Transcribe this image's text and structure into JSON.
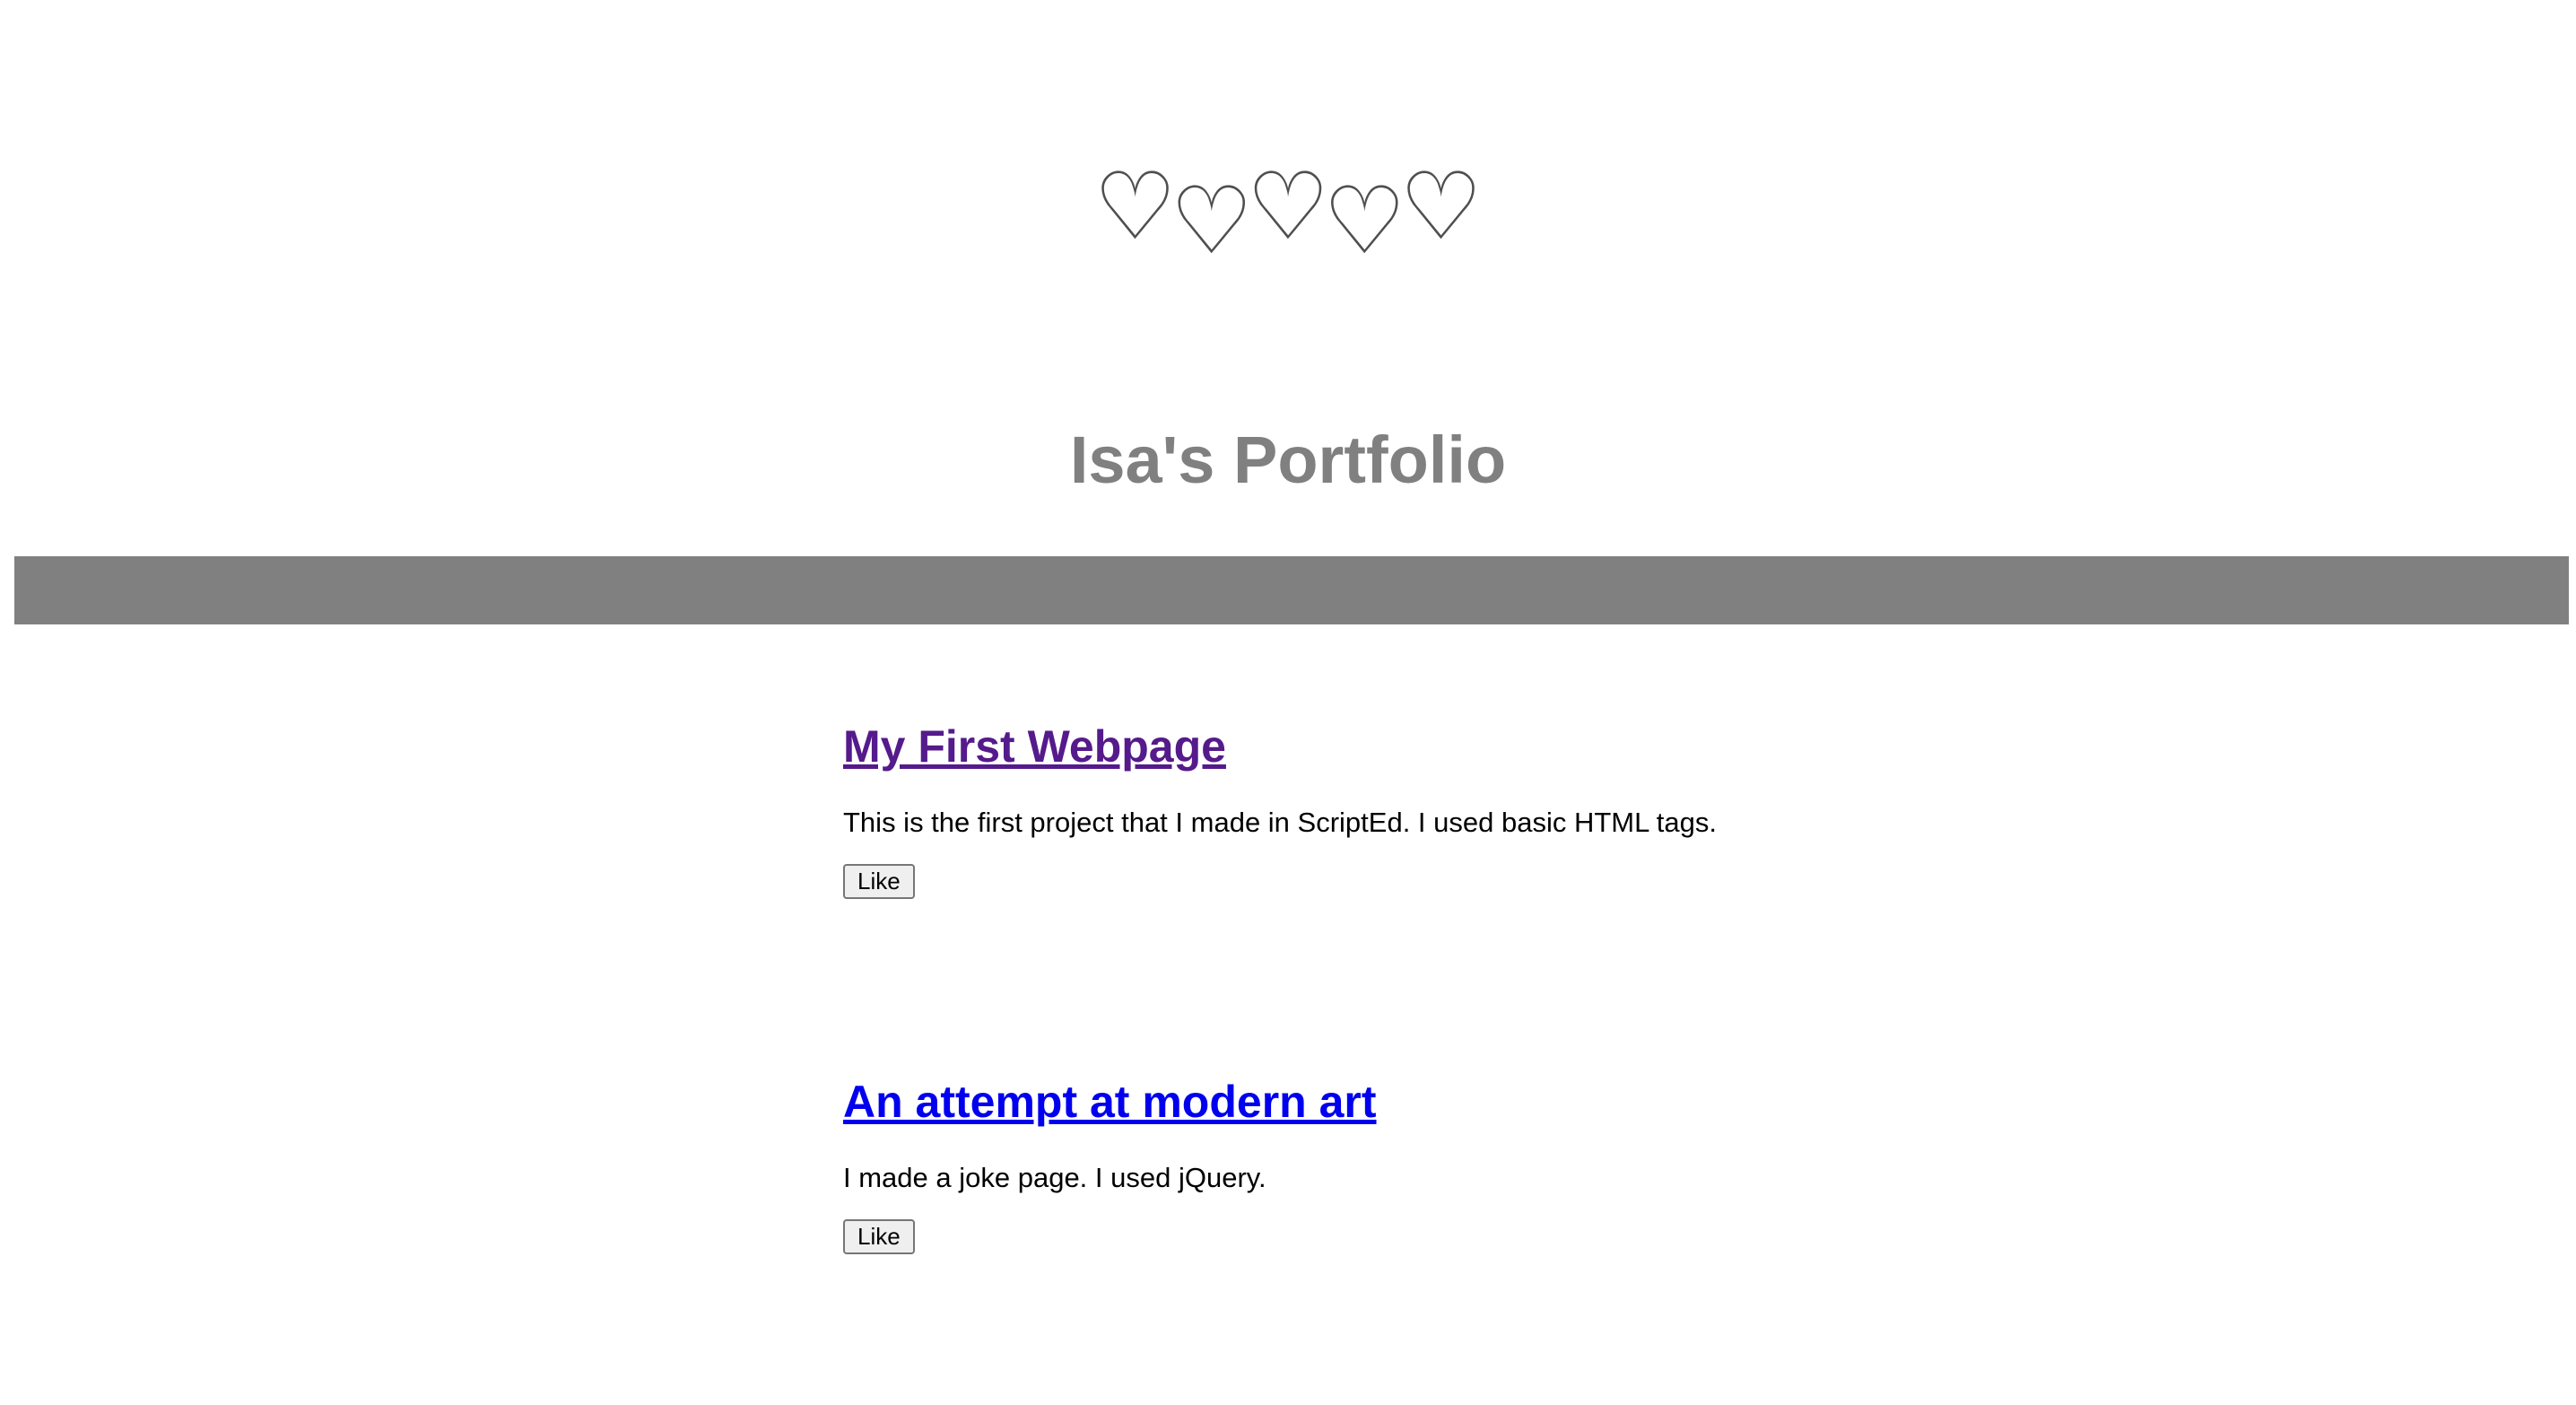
{
  "header": {
    "hearts": [
      "♡",
      "♡",
      "♡",
      "♡",
      "♡"
    ],
    "title": "Isa's Portfolio",
    "nav_bar_color": "#808080"
  },
  "projects": [
    {
      "title": "My First Webpage",
      "description": "This is the first project that I made in ScriptEd. I used basic HTML tags.",
      "like_label": "Like",
      "link_color": "#551a8b"
    },
    {
      "title": "An attempt at modern art",
      "description": "I made a joke page. I used jQuery.",
      "like_label": "Like",
      "link_color": "#0000ee"
    }
  ]
}
